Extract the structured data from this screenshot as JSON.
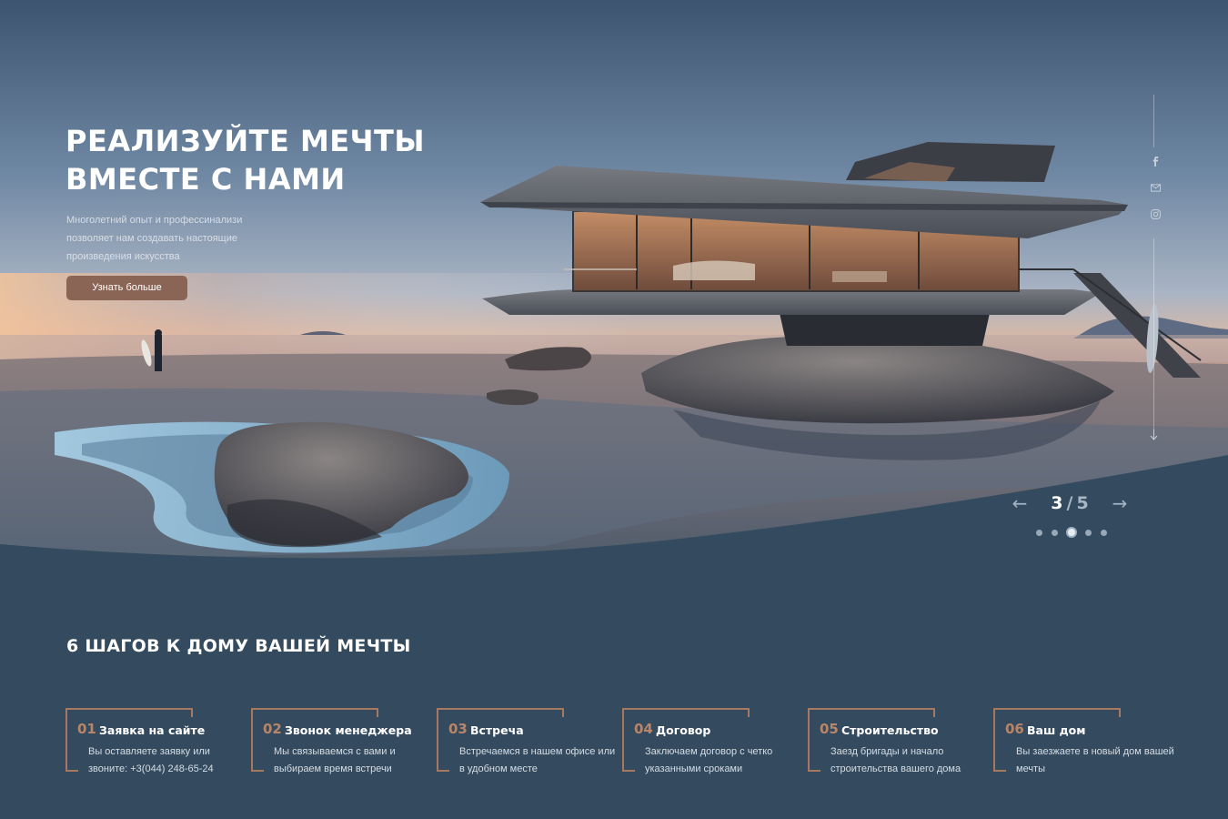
{
  "hero": {
    "title_line1": "РЕАЛИЗУЙТЕ МЕЧТЫ",
    "title_line2": "ВМЕСТЕ С НАМИ",
    "subtitle": "Многолетний опыт и профессинализи позволяет нам создавать настоящие произведения искусства",
    "cta_label": "Узнать больше"
  },
  "social": {
    "icons": [
      "facebook-icon",
      "mail-icon",
      "instagram-icon"
    ]
  },
  "slider": {
    "prev_arrow": "←",
    "next_arrow": "→",
    "current": "3",
    "separator": "/",
    "total": "5",
    "active_dot": 3,
    "dots_count": 5
  },
  "steps_section": {
    "title": "6 ШАГОВ К ДОМУ ВАШЕЙ МЕЧТЫ",
    "steps": [
      {
        "num": "01",
        "name": "Заявка на сайте",
        "desc": "Вы оставляете заявку или звоните: +3(044) 248-65-24"
      },
      {
        "num": "02",
        "name": "Звонок менеджера",
        "desc": "Мы связываемся с вами и выбираем время встречи"
      },
      {
        "num": "03",
        "name": "Встреча",
        "desc": "Встречаемся в нашем офисе или в удобном месте"
      },
      {
        "num": "04",
        "name": "Договор",
        "desc": "Заключаем договор с четко указанными сроками"
      },
      {
        "num": "05",
        "name": "Строительство",
        "desc": "Заезд бригады и начало строительства вашего дома"
      },
      {
        "num": "06",
        "name": "Ваш дом",
        "desc": "Вы заезжаете в новый дом вашей мечты"
      }
    ]
  },
  "colors": {
    "background": "#344b5f",
    "accent": "#a5785f",
    "button": "#8a6556"
  }
}
